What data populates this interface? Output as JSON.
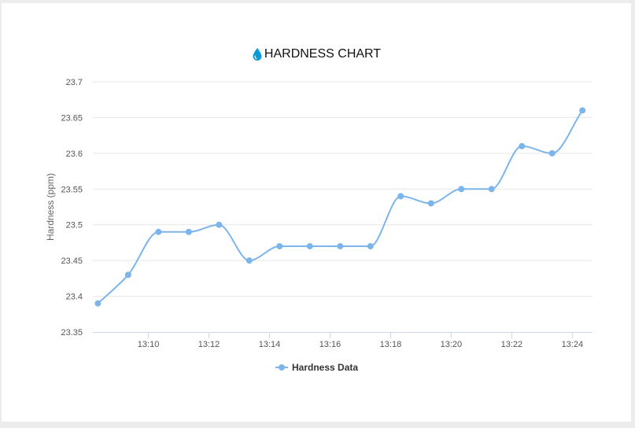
{
  "header": {
    "title": "HARDNESS CHART",
    "icon": "water-drop-icon",
    "icon_color": "#0b9ad8"
  },
  "chart_data": {
    "type": "line",
    "title": "HARDNESS CHART",
    "xlabel": "",
    "ylabel": "Hardness (ppm)",
    "ylim": [
      23.35,
      23.7
    ],
    "yticks": [
      "23.35",
      "23.4",
      "23.45",
      "23.5",
      "23.55",
      "23.6",
      "23.65",
      "23.7"
    ],
    "xticks": [
      "13:10",
      "13:12",
      "13:14",
      "13:16",
      "13:18",
      "13:20",
      "13:22",
      "13:24"
    ],
    "x": [
      "13:08:20",
      "13:09:20",
      "13:10:20",
      "13:11:20",
      "13:12:20",
      "13:13:20",
      "13:14:20",
      "13:15:20",
      "13:16:20",
      "13:17:20",
      "13:18:20",
      "13:19:20",
      "13:20:20",
      "13:21:20",
      "13:22:20",
      "13:23:20",
      "13:24:20"
    ],
    "series": [
      {
        "name": "Hardness Data",
        "color": "#7cb5ec",
        "values": [
          23.39,
          23.43,
          23.49,
          23.49,
          23.5,
          23.45,
          23.47,
          23.47,
          23.47,
          23.47,
          23.54,
          23.53,
          23.55,
          23.55,
          23.61,
          23.6,
          23.66
        ]
      }
    ],
    "grid": true,
    "legend": "bottom-center"
  }
}
